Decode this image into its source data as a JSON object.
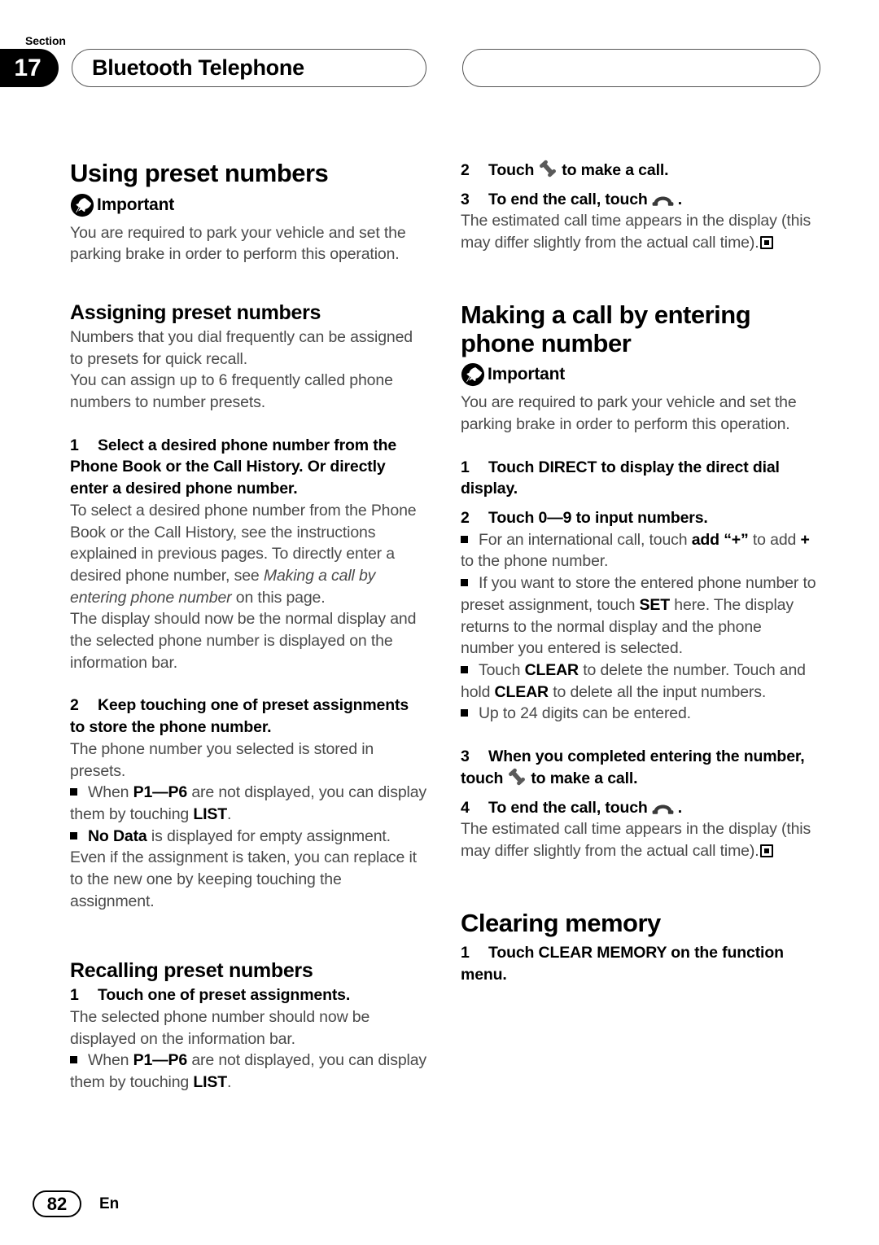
{
  "header": {
    "section_label": "Section",
    "section_number": "17",
    "chapter_title": "Bluetooth Telephone",
    "right_pill_text": ""
  },
  "left_column": {
    "h1_using_preset_numbers": "Using preset numbers",
    "important_label": "Important",
    "important_body": "You are required to park your vehicle and set the parking brake in order to perform this operation.",
    "h2_assigning": "Assigning preset numbers",
    "assigning_body_1": "Numbers that you dial frequently can be assigned to presets for quick recall.",
    "assigning_body_2": "You can assign up to 6 frequently called phone numbers to number presets.",
    "step1_num": "1",
    "step1_title": "Select a desired phone number from the Phone Book or the Call History. Or directly enter a desired phone number.",
    "step1_body_a": "To select a desired phone number from the Phone Book or the Call History, see the instructions explained in previous pages. To directly enter a desired phone number, see ",
    "step1_body_italic": "Making a call by entering phone number",
    "step1_body_b": " on this page.",
    "step1_body_c": "The display should now be the normal display and the selected phone number is displayed on the information bar.",
    "step2_num": "2",
    "step2_title": "Keep touching one of preset assignments to store the phone number.",
    "step2_body": "The phone number you selected is stored in presets.",
    "step2_bullet1_pre": "When ",
    "step2_bullet1_kw1": "P1—P6",
    "step2_bullet1_mid": " are not displayed, you can display them by touching ",
    "step2_bullet1_kw2": "LIST",
    "step2_bullet1_post": ".",
    "step2_bullet2_kw": "No Data",
    "step2_bullet2_text": " is displayed for empty assignment. Even if the assignment is taken, you can replace it to the new one by keeping touching the assignment.",
    "h2_recalling": "Recalling preset numbers",
    "recall_step1_num": "1",
    "recall_step1_title": "Touch one of preset assignments.",
    "recall_step1_body": "The selected phone number should now be displayed on the information bar.",
    "recall_bullet_pre": "When ",
    "recall_bullet_kw1": "P1—P6",
    "recall_bullet_mid": " are not displayed, you can display them by touching ",
    "recall_bullet_kw2": "LIST",
    "recall_bullet_post": "."
  },
  "right_column": {
    "step2_num": "2",
    "step2_text_pre": "Touch",
    "step2_text_post": "to make a call.",
    "step3_num": "3",
    "step3_text_pre": "To end the call, touch",
    "step3_text_post": ".",
    "step3_body": "The estimated call time appears in the display (this may differ slightly from the actual call time).",
    "h1_making_a_call": "Making a call by entering phone number",
    "important_label": "Important",
    "important_body": "You are required to park your vehicle and set the parking brake in order to perform this operation.",
    "m_step1_num": "1",
    "m_step1_title": "Touch DIRECT to display the direct dial display.",
    "m_step2_num": "2",
    "m_step2_title": "Touch 0—9 to input numbers.",
    "m_bullet1_pre": "For an international call, touch ",
    "m_bullet1_kw": "add “+”",
    "m_bullet1_mid": " to add ",
    "m_bullet1_plus": "+",
    "m_bullet1_post": " to the phone number.",
    "m_bullet2_pre": "If you want to store the entered phone number to preset assignment, touch ",
    "m_bullet2_kw": "SET",
    "m_bullet2_post": " here. The display returns to the normal display and the phone number you entered is selected.",
    "m_bullet3_pre": "Touch ",
    "m_bullet3_kw1": "CLEAR",
    "m_bullet3_mid": " to delete the number. Touch and hold ",
    "m_bullet3_kw2": "CLEAR",
    "m_bullet3_post": " to delete all the input numbers.",
    "m_bullet4": "Up to 24 digits can be entered.",
    "m_step3_num": "3",
    "m_step3_text_pre": "When you completed entering the number, touch",
    "m_step3_text_post": "to make a call.",
    "m_step4_num": "4",
    "m_step4_text_pre": "To end the call, touch",
    "m_step4_text_post": ".",
    "m_step4_body": "The estimated call time appears in the display (this may differ slightly from the actual call time).",
    "h1_clearing_memory": "Clearing memory",
    "c_step1_num": "1",
    "c_step1_title": "Touch CLEAR MEMORY on the function menu."
  },
  "footer": {
    "page_number": "82",
    "language_code": "En"
  },
  "icons": {
    "pin": "pushpin-icon",
    "phone_offhook": "phone-offhook-icon",
    "phone_onhook": "phone-onhook-icon",
    "end_of_section": "end-of-section-marker"
  },
  "colors": {
    "text_black": "#000000",
    "body_gray": "#4a4a4a",
    "pill_border": "#555555"
  }
}
